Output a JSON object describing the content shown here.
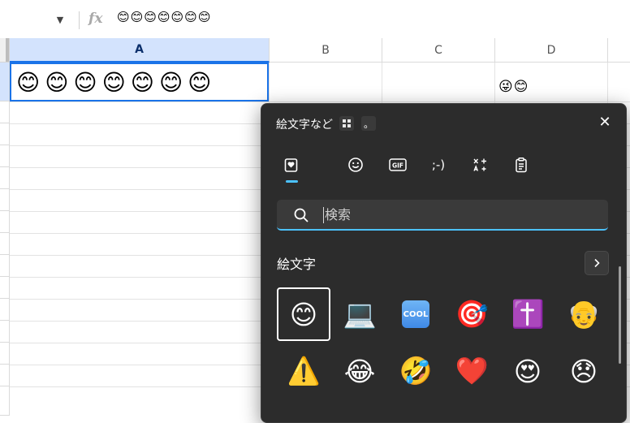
{
  "formula_bar": {
    "name_box_dropdown_icon": "caret-down-icon",
    "fx_label": "fx",
    "content": "😊😊😊😊😊😊😊"
  },
  "sheet": {
    "columns": [
      "A",
      "B",
      "C",
      "D"
    ],
    "selected_column": "A",
    "cells": {
      "A1": "😊😊😊😊😊😊😊",
      "D1": "😜😊"
    },
    "selection_color": "#1a73e8",
    "selected_header_color": "#d3e3fd"
  },
  "emoji_panel": {
    "title": "絵文字など",
    "period_button_label": "。",
    "layout_icon": "grid-layout-icon",
    "close_icon": "close-icon",
    "tabs": [
      {
        "name": "recent",
        "icon": "heart-clipboard-icon",
        "active": true
      },
      {
        "name": "emoji",
        "icon": "smiley-icon",
        "active": false
      },
      {
        "name": "gif",
        "icon": "gif-icon",
        "active": false
      },
      {
        "name": "kaomoji",
        "icon": "kaomoji-icon",
        "label": ";-)",
        "active": false
      },
      {
        "name": "symbols",
        "icon": "symbols-icon",
        "active": false
      },
      {
        "name": "clipboard",
        "icon": "clipboard-icon",
        "active": false
      }
    ],
    "search": {
      "placeholder": "検索",
      "value": ""
    },
    "section": {
      "title": "絵文字",
      "arrow_icon": "chevron-right-icon"
    },
    "emojis": [
      {
        "char": "😊",
        "selected": true
      },
      {
        "char": "💻",
        "selected": false
      },
      {
        "char": "🆒",
        "label": "COOL",
        "selected": false
      },
      {
        "char": "🎯",
        "selected": false
      },
      {
        "char": "✝️",
        "selected": false
      },
      {
        "char": "👴",
        "selected": false
      },
      {
        "char": "⚠️",
        "selected": false
      },
      {
        "char": "😂",
        "selected": false
      },
      {
        "char": "🤣",
        "selected": false
      },
      {
        "char": "❤️",
        "selected": false
      },
      {
        "char": "😍",
        "selected": false
      },
      {
        "char": "😞",
        "selected": false
      }
    ],
    "accent_color": "#4cc2ff",
    "background_color": "#2c2c2c"
  }
}
